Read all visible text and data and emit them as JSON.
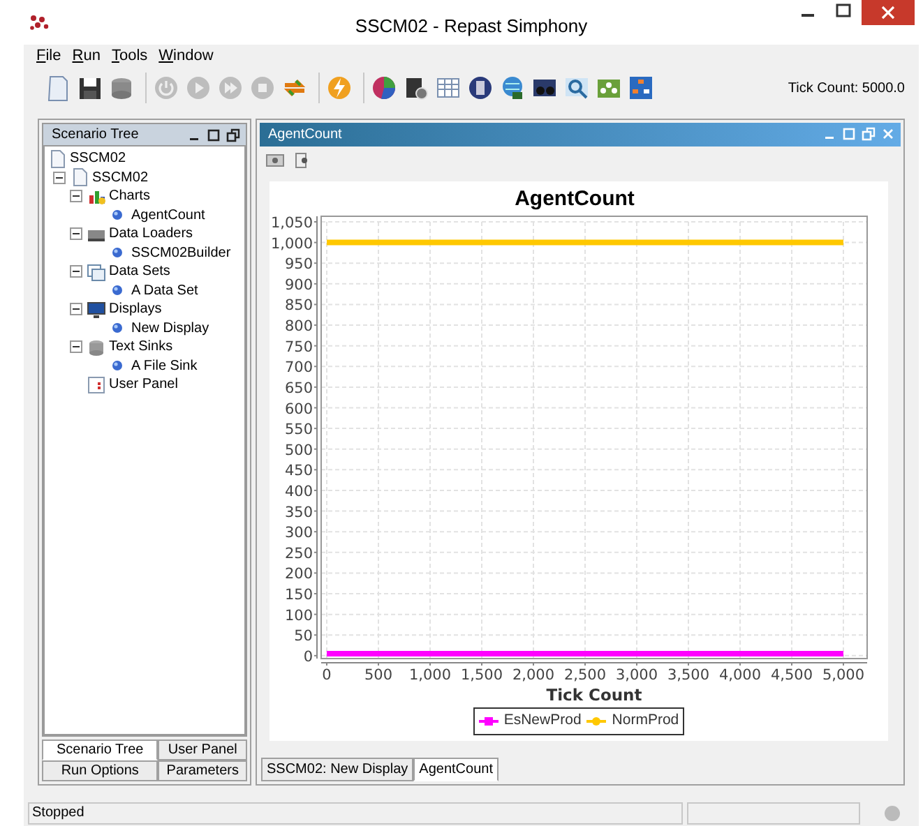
{
  "window": {
    "title": "SSCM02 - Repast Simphony"
  },
  "menu": [
    "File",
    "Run",
    "Tools",
    "Window"
  ],
  "tick_count": "Tick Count: 5000.0",
  "scenario_panel": {
    "title": "Scenario Tree",
    "tree": [
      {
        "label": "SSCM02",
        "children": [
          {
            "label": "SSCM02",
            "expanded": true,
            "children": [
              {
                "label": "Charts",
                "expanded": true,
                "children": [
                  {
                    "label": "AgentCount"
                  }
                ]
              },
              {
                "label": "Data Loaders",
                "expanded": true,
                "children": [
                  {
                    "label": "SSCM02Builder"
                  }
                ]
              },
              {
                "label": "Data Sets",
                "expanded": true,
                "children": [
                  {
                    "label": "A Data Set"
                  }
                ]
              },
              {
                "label": "Displays",
                "expanded": true,
                "children": [
                  {
                    "label": "New Display"
                  }
                ]
              },
              {
                "label": "Text Sinks",
                "expanded": true,
                "children": [
                  {
                    "label": "A File Sink"
                  }
                ]
              },
              {
                "label": "User Panel"
              }
            ]
          }
        ]
      }
    ],
    "tab_rows": [
      {
        "tabs": [
          {
            "label": "Scenario Tree",
            "selected": true
          },
          {
            "label": "User Panel",
            "selected": false
          }
        ]
      },
      {
        "tabs": [
          {
            "label": "Run Options",
            "selected": false
          },
          {
            "label": "Parameters",
            "selected": false
          }
        ]
      }
    ]
  },
  "chart_window": {
    "title": "AgentCount",
    "chart_data": {
      "type": "line",
      "title": "AgentCount",
      "xlabel": "Tick Count",
      "grid": true,
      "legend": true,
      "x": [
        0,
        5000
      ],
      "series": [
        {
          "name": "EsNewProd",
          "color": "#ff00ff",
          "values": [
            5,
            5
          ]
        },
        {
          "name": "NormProd",
          "color": "#ffc800",
          "values": [
            1000,
            1000
          ]
        }
      ],
      "xlim": [
        -54,
        5230
      ],
      "ylim": [
        -7,
        1050
      ],
      "xticks": [
        0,
        500,
        {
          "value": 1000,
          "label": "1,000"
        },
        {
          "value": 1500,
          "label": "1,500"
        },
        {
          "value": 2000,
          "label": "2,000"
        },
        {
          "value": 2500,
          "label": "2,500"
        },
        {
          "value": 3000,
          "label": "3,000"
        },
        {
          "value": 3500,
          "label": "3,500"
        },
        {
          "value": 4000,
          "label": "4,000"
        },
        {
          "value": 4500,
          "label": "4,500"
        },
        {
          "value": 5000,
          "label": "5,000"
        }
      ],
      "yticks": [
        0,
        50,
        100,
        150,
        200,
        250,
        300,
        350,
        400,
        450,
        500,
        550,
        600,
        650,
        700,
        750,
        800,
        850,
        900,
        950,
        {
          "value": 1000,
          "label": "1,000"
        },
        {
          "value": 1050,
          "label": "1,050"
        }
      ]
    },
    "tabs": [
      {
        "label": "SSCM02: New Display",
        "selected": false
      },
      {
        "label": "AgentCount",
        "selected": true
      }
    ]
  },
  "status_bar": {
    "text": "Stopped"
  }
}
